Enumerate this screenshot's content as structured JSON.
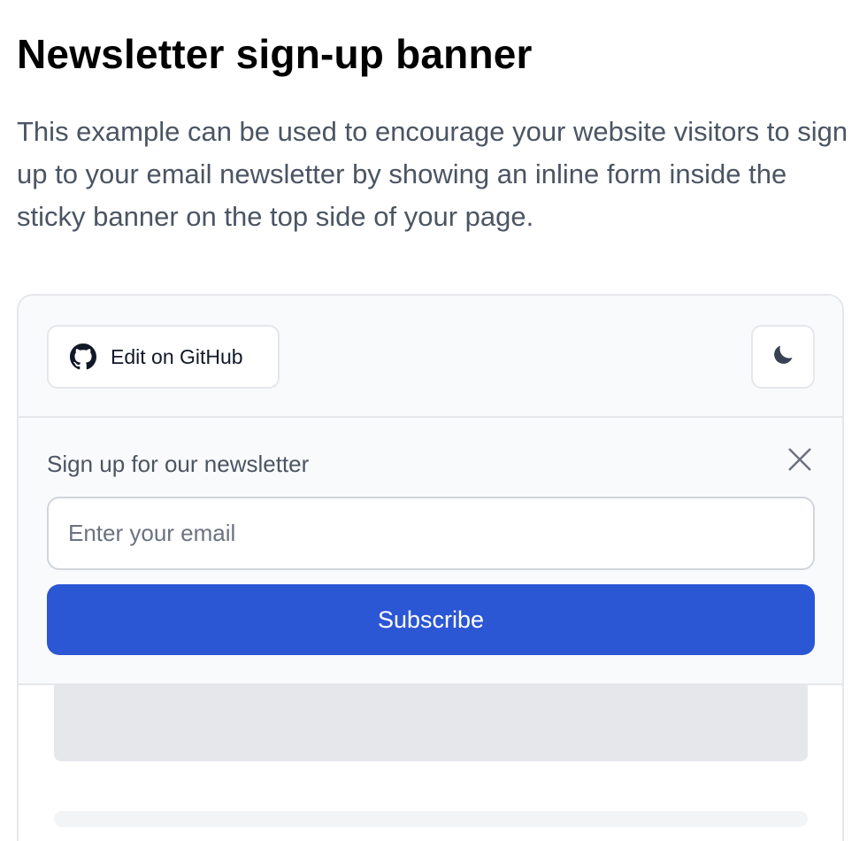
{
  "header": {
    "title": "Newsletter sign-up banner",
    "description": "This example can be used to encourage your website visitors to sign up to your email newsletter by showing an inline form inside the sticky banner on the top side of your page."
  },
  "toolbar": {
    "github_label": "Edit on GitHub",
    "github_icon": "github-icon",
    "theme_icon": "moon-icon"
  },
  "banner": {
    "label": "Sign up for our newsletter",
    "close_icon": "close-icon",
    "email_placeholder": "Enter your email",
    "email_value": "",
    "subscribe_label": "Subscribe"
  },
  "colors": {
    "accent": "#2b56d4",
    "muted_text": "#4b5563",
    "border": "#e5e7eb",
    "banner_bg": "#f9fafb"
  }
}
